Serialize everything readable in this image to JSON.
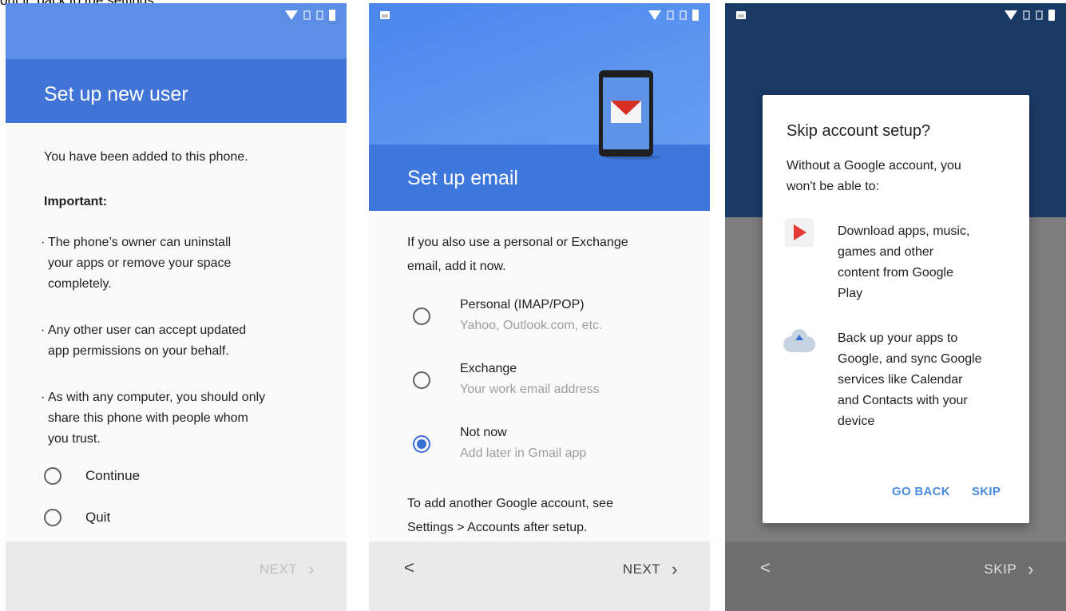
{
  "caption_fragment": "out it: back to the settings",
  "screen1": {
    "title": "Set up new user",
    "intro": "You have been added to this phone.",
    "important": "Important:",
    "bullets": [
      [
        "The phone’s owner can uninstall",
        "your apps or remove your space",
        "completely."
      ],
      [
        "Any other user can accept updated",
        "app permissions on your behalf."
      ],
      [
        "As with any computer, you should only",
        "share this phone with people whom",
        "you trust."
      ]
    ],
    "options": [
      "Continue",
      "Quit"
    ],
    "next_label": "NEXT"
  },
  "screen2": {
    "title": "Set up email",
    "intro": [
      "If you also use a personal or Exchange",
      "email, add it now."
    ],
    "options": [
      {
        "title": "Personal (IMAP/POP)",
        "subtitle": "Yahoo, Outlook.com, etc.",
        "selected": false
      },
      {
        "title": "Exchange",
        "subtitle": "Your work email address",
        "selected": false
      },
      {
        "title": "Not now",
        "subtitle": "Add later in Gmail app",
        "selected": true
      }
    ],
    "footer": [
      "To add another Google account, see",
      "Settings > Accounts after setup."
    ],
    "back_label": "<",
    "next_label": "NEXT"
  },
  "screen3": {
    "dialog_title": "Skip account setup?",
    "dialog_text": [
      "Without a Google account, you",
      "won't be able to:"
    ],
    "items": [
      {
        "icon": "google-play-icon",
        "lines": [
          "Download apps, music,",
          "games and other",
          "content from Google",
          "Play"
        ]
      },
      {
        "icon": "cloud-upload-icon",
        "lines": [
          "Back up your apps to",
          "Google, and sync Google",
          "services like Calendar",
          "and Contacts with your",
          "device"
        ]
      }
    ],
    "go_back_label": "GO BACK",
    "skip_label": "SKIP",
    "back_label": "<",
    "next_label": "SKIP"
  },
  "colors": {
    "header_blue": "#3f74d6",
    "accent_blue": "#3b6fd4",
    "dark_navy": "#1a3a66",
    "dialog_button": "#4a8cde"
  }
}
